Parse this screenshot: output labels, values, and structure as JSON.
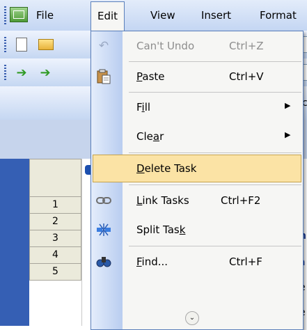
{
  "menubar": {
    "items": [
      "File",
      "Edit",
      "View",
      "Insert",
      "Format"
    ]
  },
  "toolbar2": {
    "partial_text": "c"
  },
  "sheet": {
    "row_numbers": [
      "1",
      "2",
      "3",
      "4",
      "5"
    ],
    "partial_right": [
      "(",
      "h",
      "a",
      "e",
      "e"
    ]
  },
  "edit_menu": {
    "items": [
      {
        "label": "Can't Undo",
        "shortcut": "Ctrl+Z",
        "icon": "undo-icon",
        "enabled": false
      },
      {
        "label": "Paste",
        "shortcut": "Ctrl+V",
        "icon": "paste-icon",
        "enabled": true
      },
      {
        "label": "Fill",
        "shortcut": "",
        "icon": "",
        "submenu": true,
        "enabled": true
      },
      {
        "label": "Clear",
        "shortcut": "",
        "icon": "",
        "submenu": true,
        "enabled": true
      },
      {
        "label": "Delete Task",
        "shortcut": "",
        "icon": "",
        "enabled": true,
        "highlighted": true
      },
      {
        "label": "Link Tasks",
        "shortcut": "Ctrl+F2",
        "icon": "link-icon",
        "enabled": true
      },
      {
        "label": "Split Task",
        "shortcut": "",
        "icon": "split-task-icon",
        "enabled": true
      },
      {
        "label": "Find...",
        "shortcut": "Ctrl+F",
        "icon": "find-icon",
        "enabled": true
      }
    ],
    "expand_icon": "chevron-down-icon"
  },
  "colors": {
    "menu_highlight": "#fbe3a5",
    "menu_gutter": "#c3d5f3",
    "menubar": "#d3e0f7",
    "sheet_strip": "#355fb4"
  }
}
